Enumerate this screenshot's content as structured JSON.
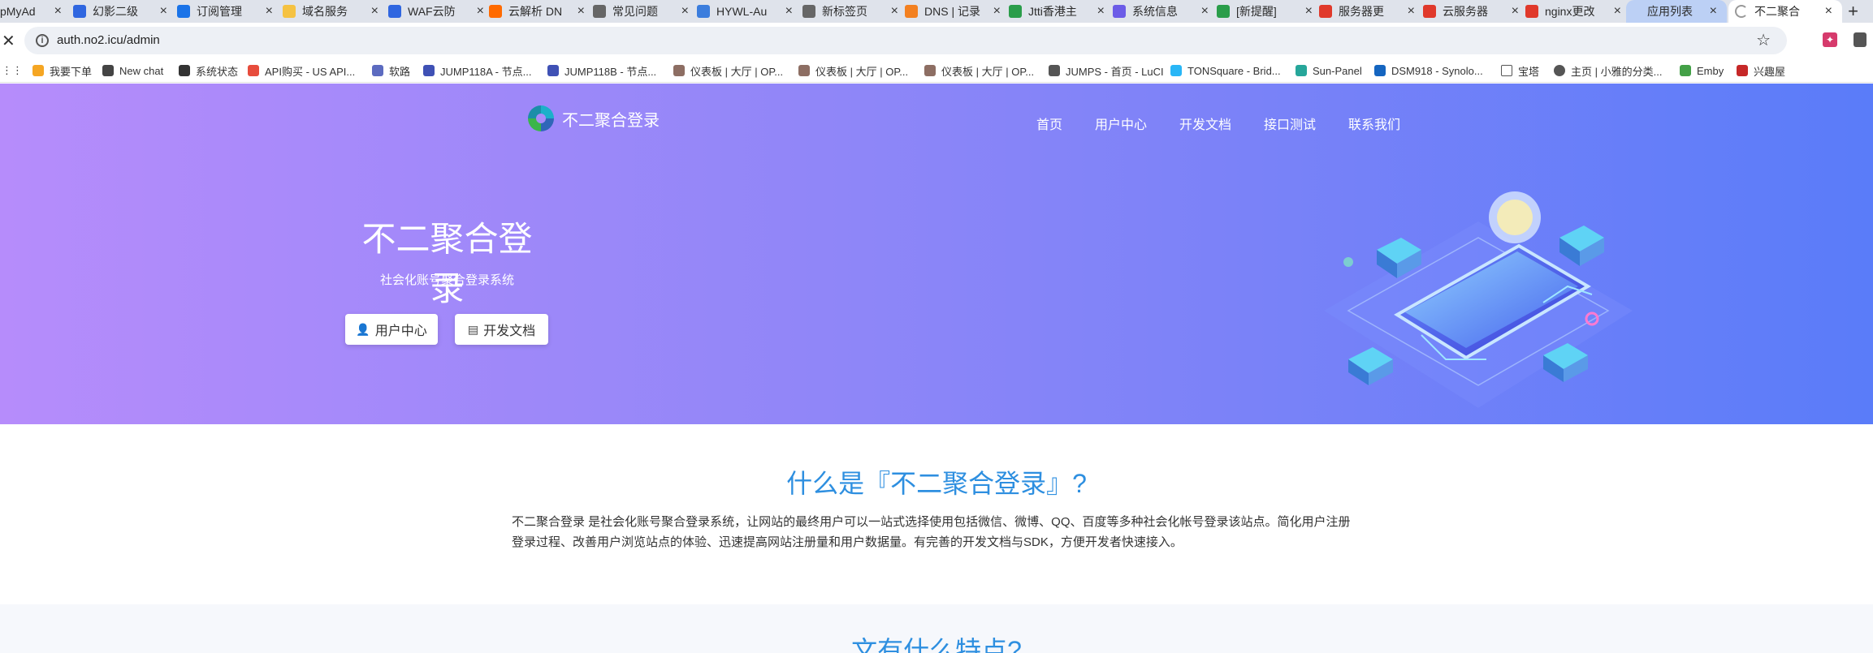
{
  "browser": {
    "tabs": [
      {
        "label": "pMyAd",
        "color": "#f08a24"
      },
      {
        "label": "幻影二级",
        "color": "#2f66e0"
      },
      {
        "label": "订阅管理",
        "color": "#1a73e8"
      },
      {
        "label": "域名服务",
        "color": "#f5c242"
      },
      {
        "label": "WAF云防",
        "color": "#2f66e0"
      },
      {
        "label": "云解析 DN",
        "color": "#ff6a00"
      },
      {
        "label": "常见问题",
        "color": "#666666"
      },
      {
        "label": "HYWL-Au",
        "color": "#3b7ddd"
      },
      {
        "label": "新标签页",
        "color": "#666666"
      },
      {
        "label": "DNS | 记录",
        "color": "#f38020"
      },
      {
        "label": "Jtti香港主",
        "color": "#2a9d4a"
      },
      {
        "label": "系统信息",
        "color": "#6c5ce7"
      },
      {
        "label": "[新提醒]",
        "color": "#2a9d4a"
      },
      {
        "label": "服务器更",
        "color": "#e0392b"
      },
      {
        "label": "云服务器",
        "color": "#e0392b"
      },
      {
        "label": "nginx更改",
        "color": "#e0392b"
      },
      {
        "label": "应用列表",
        "color": "#888888"
      },
      {
        "label": "不二聚合",
        "color": "#888888"
      }
    ],
    "url": "auth.no2.icu/admin",
    "bookmarks": [
      {
        "label": "我要下单",
        "color": "#f5a623"
      },
      {
        "label": "New chat",
        "color": "#444444"
      },
      {
        "label": "系统状态",
        "color": "#333333"
      },
      {
        "label": "API购买 - US API...",
        "color": "#e74c3c"
      },
      {
        "label": "软路",
        "color": "#5c6bc0"
      },
      {
        "label": "JUMP118A - 节点...",
        "color": "#3f51b5"
      },
      {
        "label": "JUMP118B - 节点...",
        "color": "#3f51b5"
      },
      {
        "label": "仪表板 | 大厅 | OP...",
        "color": "#8d6e63"
      },
      {
        "label": "仪表板 | 大厅 | OP...",
        "color": "#8d6e63"
      },
      {
        "label": "仪表板 | 大厅 | OP...",
        "color": "#8d6e63"
      },
      {
        "label": "JUMPS - 首页 - LuCI",
        "color": "#555555"
      },
      {
        "label": "TONSquare - Brid...",
        "color": "#29b6f6"
      },
      {
        "label": "Sun-Panel",
        "color": "#26a69a"
      },
      {
        "label": "DSM918 - Synolo...",
        "color": "#1565c0"
      },
      {
        "label": "宝塔",
        "color": "#666666"
      },
      {
        "label": "主页 | 小雅的分类...",
        "color": "#555555"
      },
      {
        "label": "Emby",
        "color": "#43a047"
      },
      {
        "label": "兴趣屋",
        "color": "#c62828"
      }
    ]
  },
  "site": {
    "logo_text": "不二聚合登录",
    "nav": [
      "首页",
      "用户中心",
      "开发文档",
      "接口测试",
      "联系我们"
    ],
    "hero": {
      "title": "不二聚合登录",
      "subtitle": "社会化账号聚合登录系统",
      "btn_user": "用户中心",
      "btn_docs": "开发文档"
    },
    "what": {
      "title": "什么是『不二聚合登录』?",
      "desc_line1": "不二聚合登录 是社会化账号聚合登录系统，让网站的最终用户可以一站式选择使用包括微信、微博、QQ、百度等多种社会化帐号登录该站点。简化用户注册",
      "desc_line2": "登录过程、改善用户浏览站点的体验、迅速提高网站注册量和用户数据量。有完善的开发文档与SDK，方便开发者快速接入。"
    },
    "lower_title": "文有什么特点?"
  },
  "colors": {
    "hero_start": "#b68cfb",
    "hero_end": "#5a7cf9",
    "accent": "#2e8fe0"
  }
}
